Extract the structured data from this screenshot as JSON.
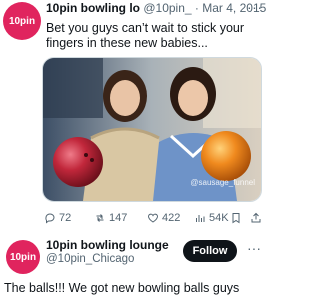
{
  "tweet1": {
    "avatar_text": "10pin",
    "display_name": "10pin bowling lo",
    "handle": "@10pin_",
    "separator": "·",
    "date": "Mar 4, 2015",
    "more": "···",
    "text": "Bet you guys can’t wait to stick your fingers in these new babies...",
    "watermark": "@sausage_funnel",
    "actions": {
      "replies": "72",
      "retweets": "147",
      "likes": "422",
      "views": "54K"
    }
  },
  "tweet2": {
    "avatar_text": "10pin",
    "display_name": "10pin bowling lounge",
    "handle": "@10pin_Chicago",
    "follow_label": "Follow",
    "more": "···",
    "text": "The balls!!! We got new bowling balls guys"
  },
  "colors": {
    "follow_bg": "#0f1419",
    "avatar_bg": "#e0245e",
    "ball_left": "#c1273b",
    "ball_right": "#f08a1e",
    "muted": "#536471"
  }
}
